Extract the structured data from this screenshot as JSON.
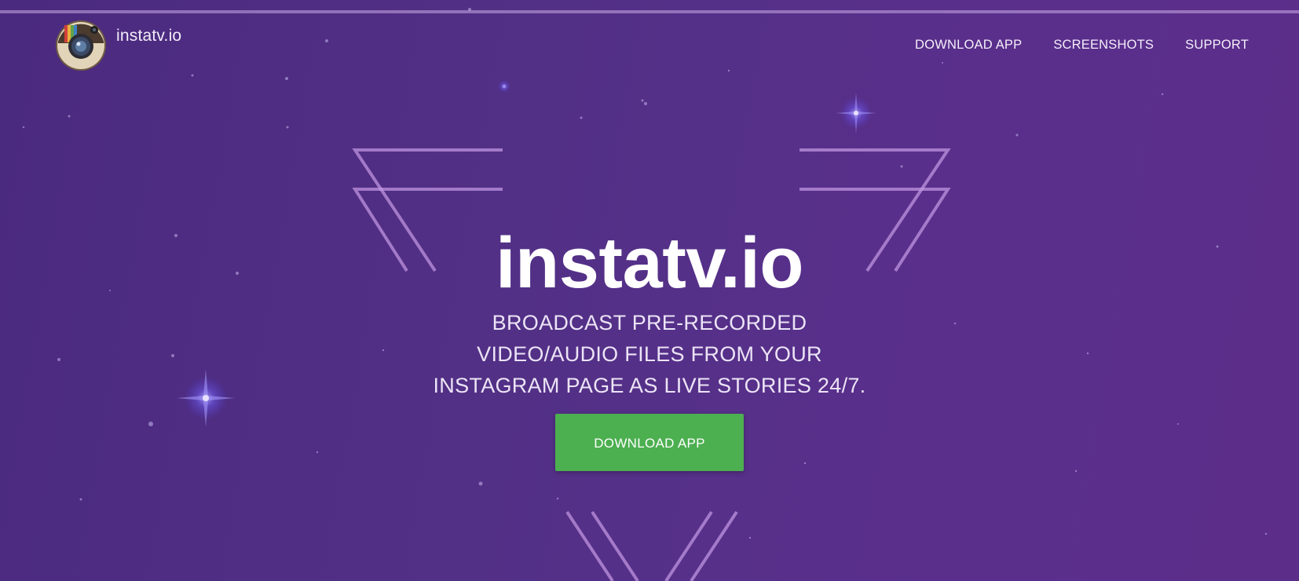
{
  "brand": {
    "name": "instatv.io",
    "logo_icon": "camera-icon"
  },
  "nav": {
    "items": [
      {
        "label": "DOWNLOAD APP"
      },
      {
        "label": "SCREENSHOTS"
      },
      {
        "label": "SUPPORT"
      }
    ]
  },
  "hero": {
    "title": "instatv.io",
    "tagline_lines": [
      "BROADCAST PRE-RECORDED",
      "VIDEO/AUDIO FILES FROM YOUR",
      "INSTAGRAM PAGE AS LIVE STORIES 24/7."
    ],
    "cta_label": "DOWNLOAD APP"
  },
  "colors": {
    "background": "#523086",
    "cta": "#4caf50",
    "line_accent": "#c69ae6"
  }
}
